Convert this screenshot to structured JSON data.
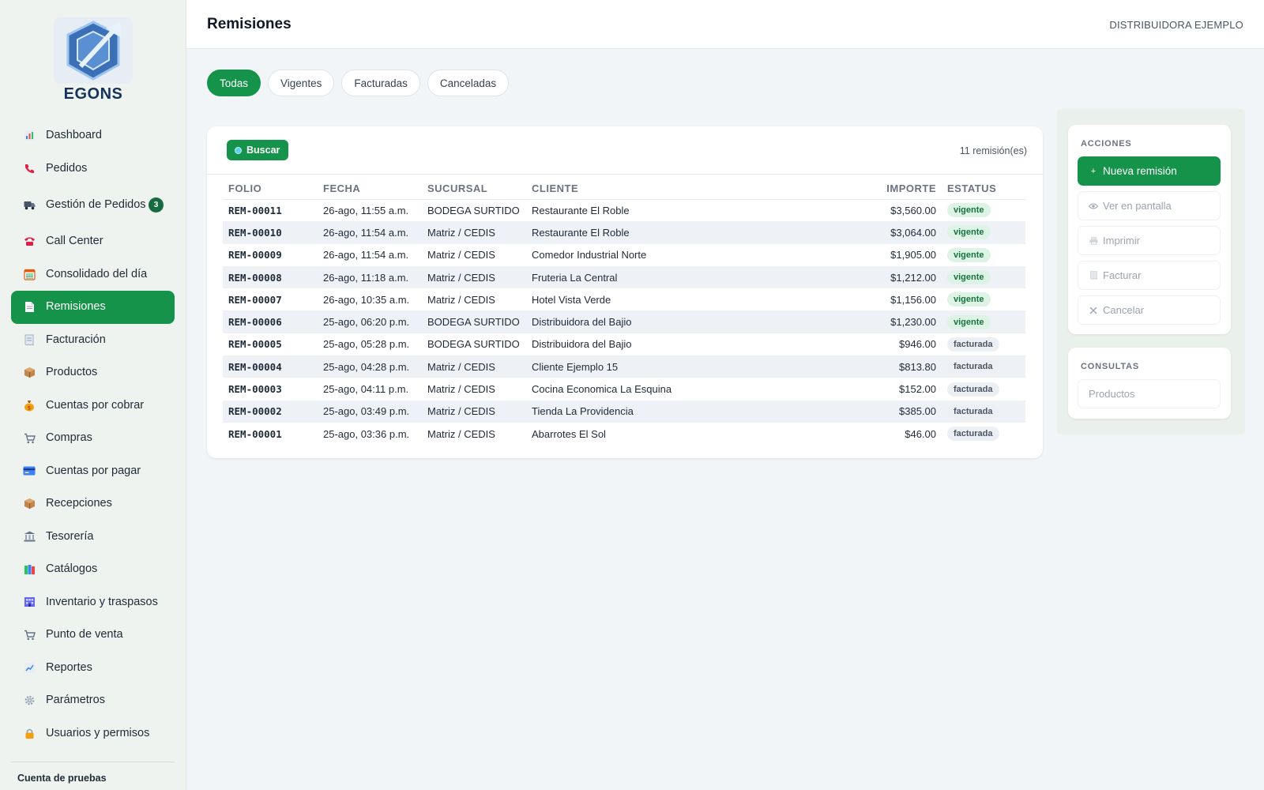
{
  "brand": {
    "logo_text": "EGONS"
  },
  "sidebar": {
    "items": [
      {
        "label": "Dashboard",
        "icon": "bar-chart-icon"
      },
      {
        "label": "Pedidos",
        "icon": "phone-icon"
      },
      {
        "label": "Gestión de Pedidos",
        "icon": "truck-icon",
        "badge": "3"
      },
      {
        "label": "Call Center",
        "icon": "telephone-icon"
      },
      {
        "label": "Consolidado del día",
        "icon": "calendar-icon"
      },
      {
        "label": "Remisiones",
        "icon": "document-icon",
        "active": true
      },
      {
        "label": "Facturación",
        "icon": "receipt-icon"
      },
      {
        "label": "Productos",
        "icon": "box-icon"
      },
      {
        "label": "Cuentas por cobrar",
        "icon": "money-bag-icon"
      },
      {
        "label": "Compras",
        "icon": "cart-icon"
      },
      {
        "label": "Cuentas por pagar",
        "icon": "credit-card-icon"
      },
      {
        "label": "Recepciones",
        "icon": "package-icon"
      },
      {
        "label": "Tesorería",
        "icon": "bank-icon"
      },
      {
        "label": "Catálogos",
        "icon": "books-icon"
      },
      {
        "label": "Inventario y traspasos",
        "icon": "warehouse-icon"
      },
      {
        "label": "Punto de venta",
        "icon": "pos-cart-icon"
      },
      {
        "label": "Reportes",
        "icon": "line-chart-icon"
      },
      {
        "label": "Parámetros",
        "icon": "gear-icon"
      },
      {
        "label": "Usuarios y permisos",
        "icon": "lock-icon"
      }
    ],
    "account_label": "Cuenta de pruebas"
  },
  "header": {
    "title": "Remisiones",
    "company": "DISTRIBUIDORA EJEMPLO"
  },
  "tabs": [
    {
      "label": "Todas",
      "active": true
    },
    {
      "label": "Vigentes",
      "active": false
    },
    {
      "label": "Facturadas",
      "active": false
    },
    {
      "label": "Canceladas",
      "active": false
    }
  ],
  "table_card": {
    "search_label": "Buscar",
    "count_label": "11 remisión(es)",
    "columns": [
      "FOLIO",
      "FECHA",
      "SUCURSAL",
      "CLIENTE",
      "IMPORTE",
      "ESTATUS"
    ],
    "rows": [
      {
        "folio": "REM-00011",
        "fecha": "26-ago, 11:55 a.m.",
        "sucursal": "BODEGA SURTIDO",
        "cliente": "Restaurante El Roble",
        "importe": "$3,560.00",
        "estatus": "vigente"
      },
      {
        "folio": "REM-00010",
        "fecha": "26-ago, 11:54 a.m.",
        "sucursal": "Matriz / CEDIS",
        "cliente": "Restaurante El Roble",
        "importe": "$3,064.00",
        "estatus": "vigente"
      },
      {
        "folio": "REM-00009",
        "fecha": "26-ago, 11:54 a.m.",
        "sucursal": "Matriz / CEDIS",
        "cliente": "Comedor Industrial Norte",
        "importe": "$1,905.00",
        "estatus": "vigente"
      },
      {
        "folio": "REM-00008",
        "fecha": "26-ago, 11:18 a.m.",
        "sucursal": "Matriz / CEDIS",
        "cliente": "Fruteria La Central",
        "importe": "$1,212.00",
        "estatus": "vigente"
      },
      {
        "folio": "REM-00007",
        "fecha": "26-ago, 10:35 a.m.",
        "sucursal": "Matriz / CEDIS",
        "cliente": "Hotel Vista Verde",
        "importe": "$1,156.00",
        "estatus": "vigente"
      },
      {
        "folio": "REM-00006",
        "fecha": "25-ago, 06:20 p.m.",
        "sucursal": "BODEGA SURTIDO",
        "cliente": "Distribuidora del Bajio",
        "importe": "$1,230.00",
        "estatus": "vigente"
      },
      {
        "folio": "REM-00005",
        "fecha": "25-ago, 05:28 p.m.",
        "sucursal": "BODEGA SURTIDO",
        "cliente": "Distribuidora del Bajio",
        "importe": "$946.00",
        "estatus": "facturada"
      },
      {
        "folio": "REM-00004",
        "fecha": "25-ago, 04:28 p.m.",
        "sucursal": "Matriz / CEDIS",
        "cliente": "Cliente Ejemplo 15",
        "importe": "$813.80",
        "estatus": "facturada"
      },
      {
        "folio": "REM-00003",
        "fecha": "25-ago, 04:11 p.m.",
        "sucursal": "Matriz / CEDIS",
        "cliente": "Cocina Economica La Esquina",
        "importe": "$152.00",
        "estatus": "facturada"
      },
      {
        "folio": "REM-00002",
        "fecha": "25-ago, 03:49 p.m.",
        "sucursal": "Matriz / CEDIS",
        "cliente": "Tienda La Providencia",
        "importe": "$385.00",
        "estatus": "facturada"
      },
      {
        "folio": "REM-00001",
        "fecha": "25-ago, 03:36 p.m.",
        "sucursal": "Matriz / CEDIS",
        "cliente": "Abarrotes El Sol",
        "importe": "$46.00",
        "estatus": "facturada"
      }
    ]
  },
  "actions": {
    "title": "ACCIONES",
    "new_label": "Nueva remisión",
    "view_label": "Ver en pantalla",
    "print_label": "Imprimir",
    "invoice_label": "Facturar",
    "cancel_label": "Cancelar"
  },
  "consultas": {
    "title": "CONSULTAS",
    "productos_label": "Productos"
  },
  "colors": {
    "accent": "#16934a",
    "vigente_bg": "#dcf3e6",
    "facturada_bg": "#eceff3"
  }
}
